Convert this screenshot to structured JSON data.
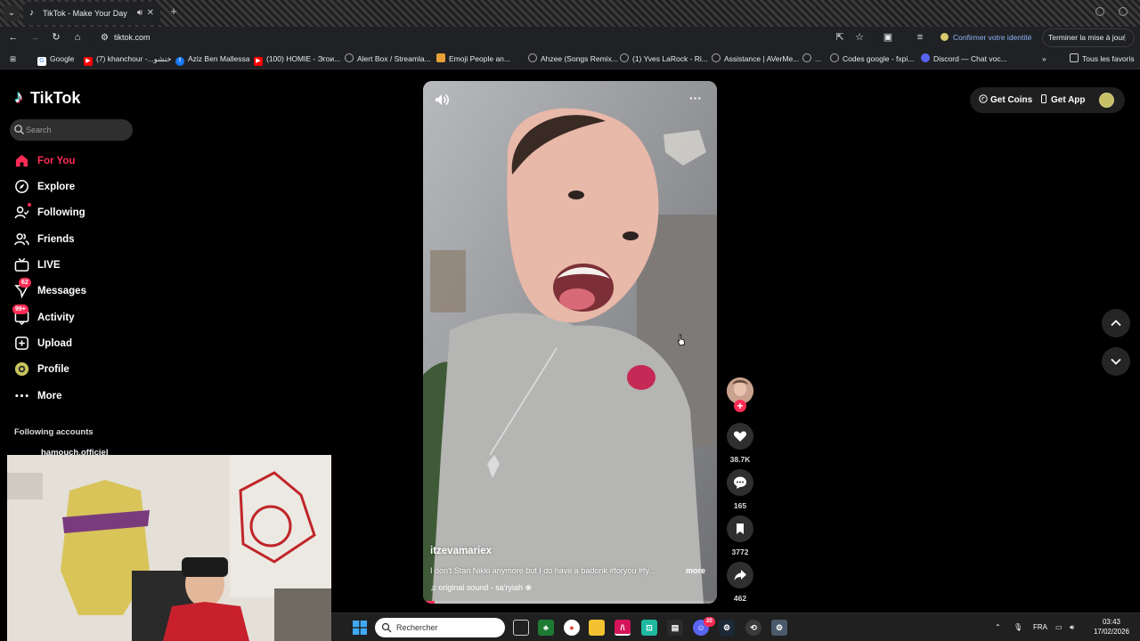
{
  "browser": {
    "tab_title": "TikTok - Make Your Day",
    "url": "tiktok.com",
    "confirm_identity": "Confirmer votre identité",
    "update_button": "Terminer la mise à jour",
    "bookmarks": [
      {
        "label": "Google",
        "color": "#4285f4"
      },
      {
        "label": "(7) khanchour -...خنشو",
        "color": "#ff0000"
      },
      {
        "label": "Aziz Ben Mallessa",
        "color": "#1877f2"
      },
      {
        "label": "(100) HOMIE - Эгои...",
        "color": "#ff0000"
      },
      {
        "label": "Alert Box / Streamla...",
        "color": "#666666"
      },
      {
        "label": "Emoji People an...",
        "color": "#e8a13a"
      },
      {
        "label": "Ahzee (Songs Remix...",
        "color": "#666666"
      },
      {
        "label": "(1) Yves LaRock - Ri...",
        "color": "#666666"
      },
      {
        "label": "Assistance | AVerMe...",
        "color": "#666666"
      },
      {
        "label": "...",
        "color": "#666666"
      },
      {
        "label": "Codes google - fxpi...",
        "color": "#666666"
      },
      {
        "label": "Discord — Chat voc...",
        "color": "#5865f2"
      }
    ],
    "all_bookmarks": "Tous les favoris"
  },
  "app": {
    "logo_text": "TikTok",
    "search_placeholder": "Search",
    "nav": [
      {
        "label": "For You",
        "icon": "home-icon",
        "active": true
      },
      {
        "label": "Explore",
        "icon": "compass-icon"
      },
      {
        "label": "Following",
        "icon": "following-icon"
      },
      {
        "label": "Friends",
        "icon": "friends-icon"
      },
      {
        "label": "LIVE",
        "icon": "live-icon"
      },
      {
        "label": "Messages",
        "icon": "messages-icon",
        "badge": "62"
      },
      {
        "label": "Activity",
        "icon": "activity-icon",
        "badge": "99+"
      },
      {
        "label": "Upload",
        "icon": "upload-icon"
      },
      {
        "label": "Profile",
        "icon": "profile-icon"
      },
      {
        "label": "More",
        "icon": "more-icon"
      }
    ],
    "following_title": "Following accounts",
    "following_account": "hamouch.officiel",
    "get_coins": "Get Coins",
    "get_app": "Get App",
    "accent": "#fe2c55"
  },
  "video": {
    "author": "itzevamariex",
    "caption": "I don't Stan Nikki anymore but I do have a badonk #foryou #fy...",
    "caption_more": "more",
    "sound": "original sound - sa'ryiah ❀",
    "likes": "38.7K",
    "comments": "165",
    "saves": "3772",
    "shares": "462",
    "progress": 0.04
  },
  "taskbar": {
    "search_placeholder": "Rechercher",
    "language": "FRA",
    "time": "03:43",
    "date": "17/02/2026",
    "discord_badge": "20"
  }
}
